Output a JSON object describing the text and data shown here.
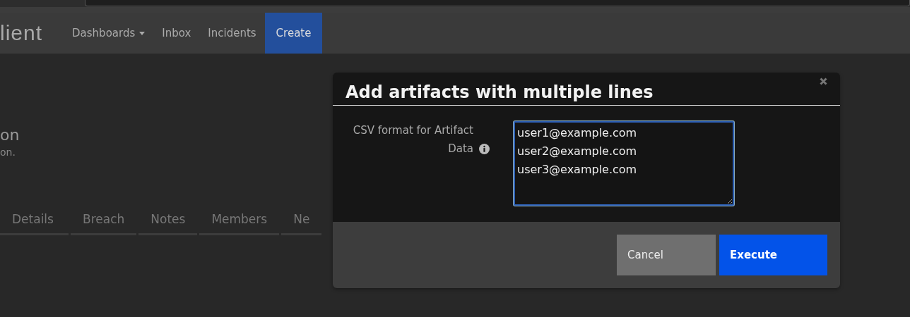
{
  "nav": {
    "logo": "lient",
    "items": [
      {
        "label": "Dashboards",
        "dropdown": true,
        "selected": false
      },
      {
        "label": "Inbox",
        "dropdown": false,
        "selected": false
      },
      {
        "label": "Incidents",
        "dropdown": false,
        "selected": false
      },
      {
        "label": "Create",
        "dropdown": false,
        "selected": true
      }
    ]
  },
  "page": {
    "title": "on",
    "subtitle": "on.",
    "tabs": [
      {
        "label": "Details",
        "selected": false
      },
      {
        "label": "Breach",
        "selected": false
      },
      {
        "label": "Notes",
        "selected": false
      },
      {
        "label": "Members",
        "selected": false
      },
      {
        "label": "Ne",
        "selected": false
      }
    ]
  },
  "dialog": {
    "title": "Add artifacts with multiple lines",
    "field_label": "CSV format for Artifact Data",
    "value": "user1@example.com\nuser2@example.com\nuser3@example.com\n",
    "buttons": [
      {
        "label": "Cancel",
        "kind": "secondary"
      },
      {
        "label": "Execute",
        "kind": "primary"
      }
    ]
  }
}
